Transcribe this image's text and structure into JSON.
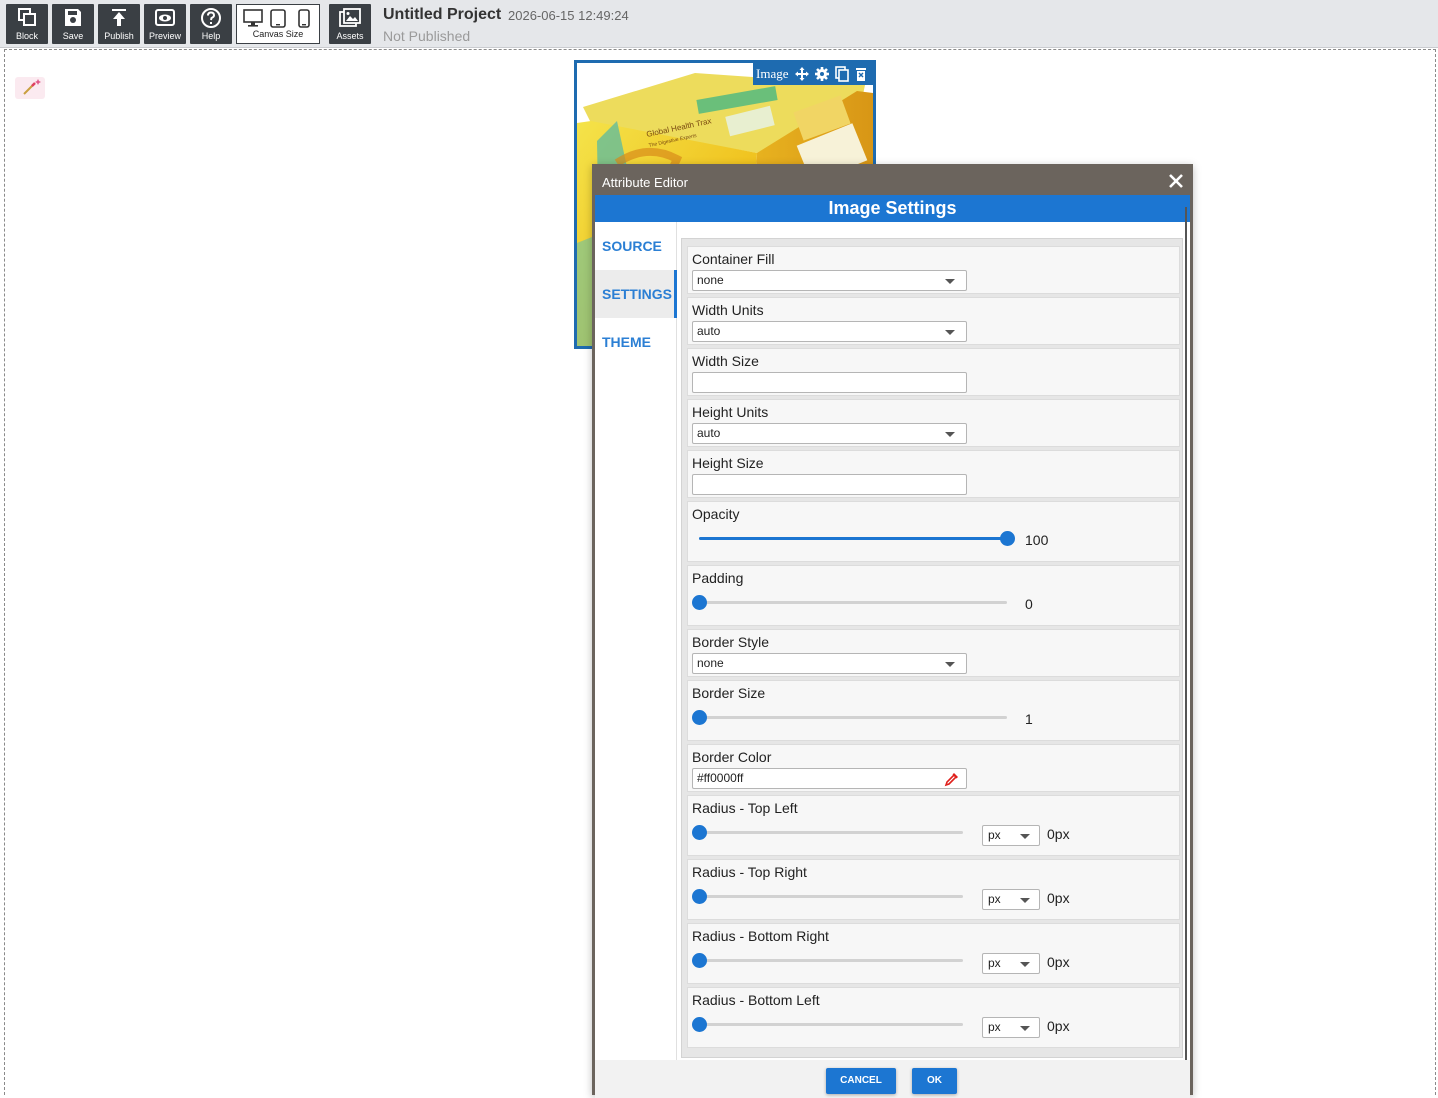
{
  "toolbar": {
    "block_label": "Block",
    "save_label": "Save",
    "publish_label": "Publish",
    "preview_label": "Preview",
    "help_label": "Help",
    "canvas_size_label": "Canvas Size",
    "assets_label": "Assets"
  },
  "project": {
    "title": "Untitled Project",
    "datetime": "2026-06-15 12:49:24",
    "status": "Not Published"
  },
  "image_block": {
    "toolbar_label": "Image",
    "product_text_1": "Global Health Trax",
    "product_text_2": "The Digestive Experts"
  },
  "editor": {
    "window_title": "Attribute Editor",
    "header": "Image Settings",
    "tabs": [
      "SOURCE",
      "SETTINGS",
      "THEME"
    ],
    "active_tab": "SETTINGS",
    "fields": {
      "container_fill": {
        "label": "Container Fill",
        "value": "none"
      },
      "width_units": {
        "label": "Width Units",
        "value": "auto"
      },
      "width_size": {
        "label": "Width Size",
        "value": ""
      },
      "height_units": {
        "label": "Height Units",
        "value": "auto"
      },
      "height_size": {
        "label": "Height Size",
        "value": ""
      },
      "opacity": {
        "label": "Opacity",
        "value": "100",
        "level": 1.0
      },
      "padding": {
        "label": "Padding",
        "value": "0",
        "level": 0.0
      },
      "border_style": {
        "label": "Border Style",
        "value": "none"
      },
      "border_size": {
        "label": "Border Size",
        "value": "1",
        "level": 0.0
      },
      "border_color": {
        "label": "Border Color",
        "value": "#ff0000ff"
      },
      "radius_top_left": {
        "label": "Radius - Top Left",
        "unit": "px",
        "value": "0px",
        "level": 0.0
      },
      "radius_top_right": {
        "label": "Radius - Top Right",
        "unit": "px",
        "value": "0px",
        "level": 0.0
      },
      "radius_bottom_right": {
        "label": "Radius - Bottom Right",
        "unit": "px",
        "value": "0px",
        "level": 0.0
      },
      "radius_bottom_left": {
        "label": "Radius - Bottom Left",
        "unit": "px",
        "value": "0px",
        "level": 0.0
      }
    },
    "cancel_label": "CANCEL",
    "ok_label": "OK"
  },
  "colors": {
    "accent": "#1c76d2",
    "titlebar": "#6b645d",
    "toolbar_button": "#3a3f44",
    "selection": "#1e6bb0"
  },
  "icons": [
    "blocks-icon",
    "save-icon",
    "publish-icon",
    "preview-icon",
    "help-icon",
    "desktop-icon",
    "tablet-icon",
    "mobile-icon",
    "assets-icon",
    "magic-wand-icon",
    "move-icon",
    "gear-icon",
    "copy-icon",
    "delete-icon",
    "close-icon",
    "color-picker-icon"
  ]
}
